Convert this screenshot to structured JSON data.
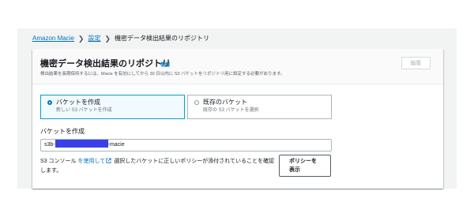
{
  "breadcrumb": {
    "items": [
      "Amazon Macie",
      "設定"
    ],
    "current": "機密データ検出結果のリポジトリ"
  },
  "panel": {
    "title": "機密データ検出結果のリポジトリ",
    "info_label": "情報",
    "description": "検出結果を長期保持するには、Macie を有効にしてから 30 日以内に S3 バケットをリポジトリ用に設定する必要があります。",
    "edit_label": "編集"
  },
  "options": [
    {
      "label": "バケットを作成",
      "sublabel": "新しい S3 バケットを作成",
      "selected": true
    },
    {
      "label": "既存のバケット",
      "sublabel": "既存の S3 バケットを選択",
      "selected": false
    }
  ],
  "bucket": {
    "label": "バケットを作成",
    "prefix": "s3b-",
    "suffix": "-macie"
  },
  "help": {
    "text_before": "S3 コンソール ",
    "link_text": "を使用して",
    "text_after": " 選択したバケットに正しいポリシーが添付されていることを確認します。"
  },
  "policy_button": {
    "line1": "ポリシーを",
    "line2": "表示"
  },
  "colors": {
    "link": "#0073bb",
    "selected_tile_bg": "#f1faff",
    "selected_tile_border": "#00a1c9",
    "redaction": "#3b3fe8"
  },
  "icons": {
    "separator": "chevron-right-icon",
    "external": "external-link-icon"
  }
}
